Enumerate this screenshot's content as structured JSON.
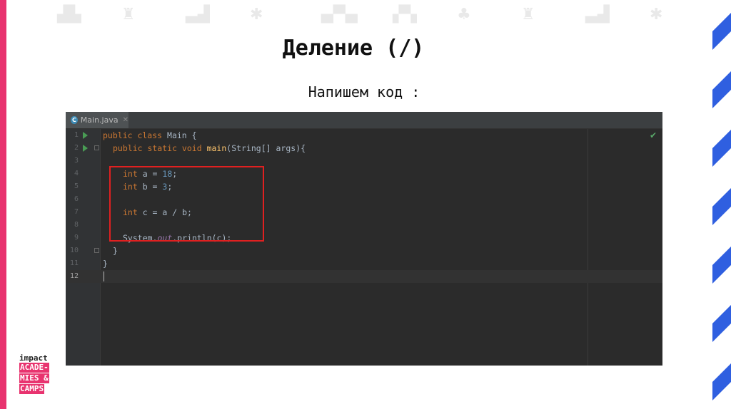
{
  "slide": {
    "title": "Деление (/)",
    "subtitle": "Напишем код :"
  },
  "ide": {
    "tab_label": "Main.java",
    "tab_icon": "C",
    "lines": [
      {
        "n": "1"
      },
      {
        "n": "2"
      },
      {
        "n": "3"
      },
      {
        "n": "4"
      },
      {
        "n": "5"
      },
      {
        "n": "6"
      },
      {
        "n": "7"
      },
      {
        "n": "8"
      },
      {
        "n": "9"
      },
      {
        "n": "10"
      },
      {
        "n": "11"
      },
      {
        "n": "12"
      }
    ],
    "code": {
      "l1_kw": "public class",
      "l1_rest": " Main {",
      "l2_kw": "public static void",
      "l2_fn": "main",
      "l2_rest": "(String[] args){",
      "l4_kw": "int",
      "l4_mid": " a = ",
      "l4_num": "18",
      "l4_end": ";",
      "l5_kw": "int",
      "l5_mid": " b = ",
      "l5_num": "3",
      "l5_end": ";",
      "l7_kw": "int",
      "l7_rest": " c = a / b;",
      "l9_a": "System.",
      "l9_it": "out",
      "l9_b": ".println(c);",
      "l10": "}",
      "l11": "}"
    },
    "check_icon": "✔",
    "accent_highlight": "#e02020"
  },
  "logo": {
    "top": "impact",
    "lines": [
      "ACADE-",
      "MIES &",
      "CAMPS"
    ]
  }
}
